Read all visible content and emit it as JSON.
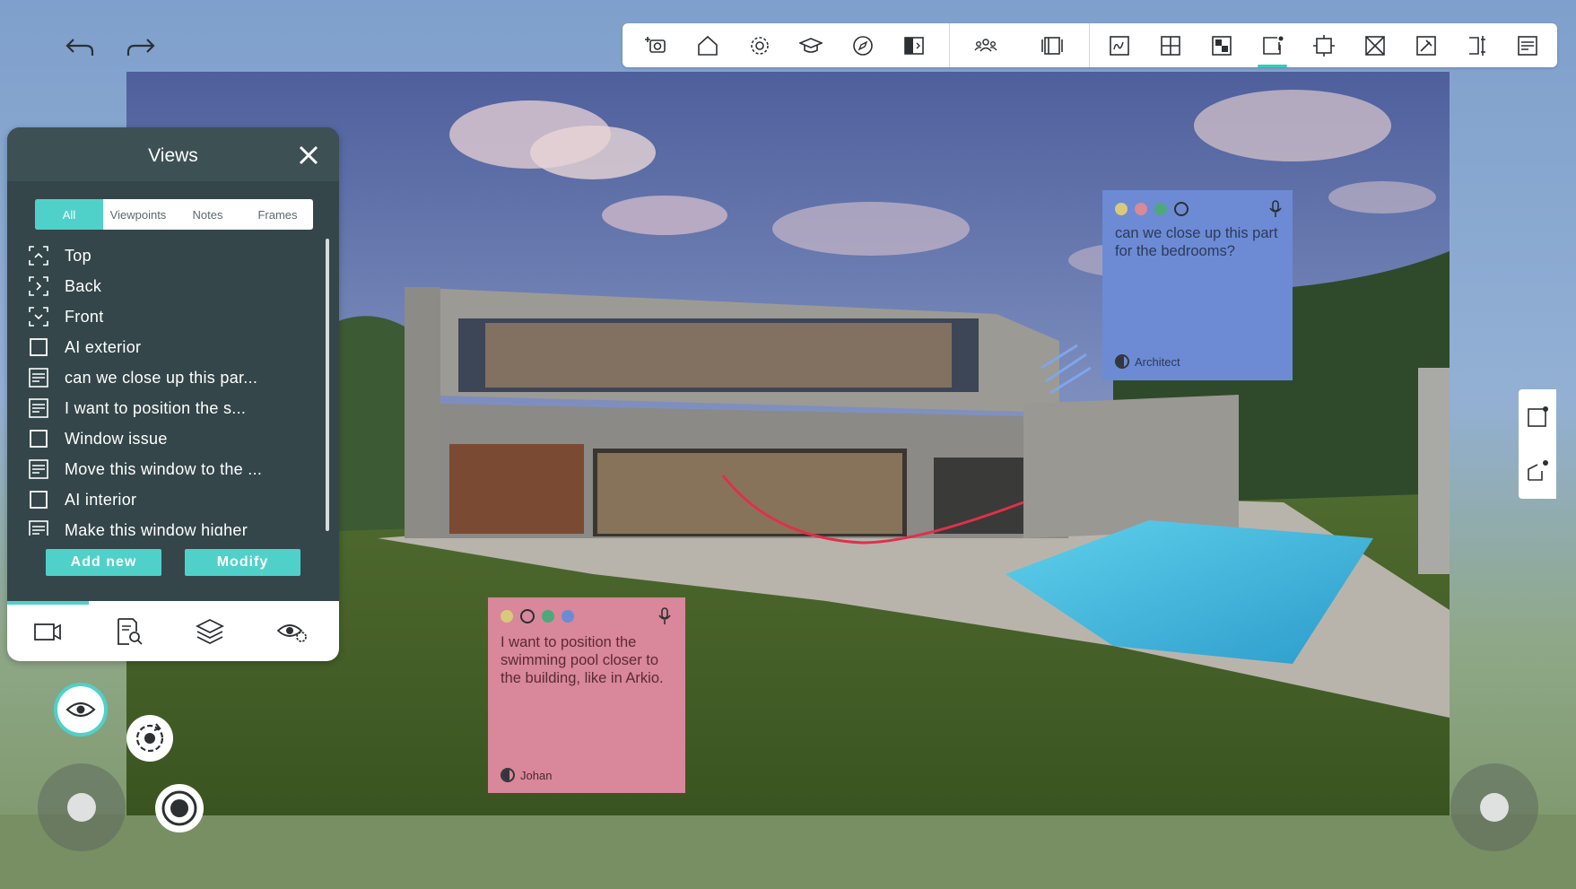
{
  "history": {
    "undo_icon": "undo-icon",
    "redo_icon": "redo-icon"
  },
  "toolbar": {
    "tools": [
      {
        "name": "add-viewpoint",
        "icon": "camera-plus-icon"
      },
      {
        "name": "home",
        "icon": "home-icon"
      },
      {
        "name": "settings",
        "icon": "gear-icon"
      },
      {
        "name": "tutorial",
        "icon": "graduation-cap-icon"
      },
      {
        "name": "compass",
        "icon": "compass-icon"
      },
      {
        "name": "split-view",
        "icon": "split-panel-icon"
      },
      {
        "name": "users",
        "icon": "users-icon"
      },
      {
        "name": "panels",
        "icon": "panels-icon"
      },
      {
        "name": "sketch",
        "icon": "sketch-icon"
      },
      {
        "name": "add-object",
        "icon": "plus-square-icon"
      },
      {
        "name": "materials",
        "icon": "checker-icon"
      },
      {
        "name": "views",
        "icon": "view-frame-icon"
      },
      {
        "name": "frame-select",
        "icon": "frame-select-icon"
      },
      {
        "name": "remove",
        "icon": "x-square-icon"
      },
      {
        "name": "pin",
        "icon": "pin-icon"
      },
      {
        "name": "section",
        "icon": "section-icon"
      },
      {
        "name": "notes",
        "icon": "notes-icon"
      }
    ],
    "active_tool": "views",
    "accent_color": "#2fd0b7"
  },
  "views_panel": {
    "title": "Views",
    "tabs": [
      {
        "label": "All",
        "active": true
      },
      {
        "label": "Viewpoints",
        "active": false
      },
      {
        "label": "Notes",
        "active": false
      },
      {
        "label": "Frames",
        "active": false
      }
    ],
    "items": [
      {
        "label": "Top",
        "icon": "viewpoint-icon"
      },
      {
        "label": "Back",
        "icon": "viewpoint-icon"
      },
      {
        "label": "Front",
        "icon": "viewpoint-icon"
      },
      {
        "label": "AI exterior",
        "icon": "frame-icon"
      },
      {
        "label": "can we close up this par...",
        "icon": "note-icon"
      },
      {
        "label": "I want to position the s...",
        "icon": "note-icon"
      },
      {
        "label": "Window issue",
        "icon": "frame-icon"
      },
      {
        "label": "Move this window to the ...",
        "icon": "note-icon"
      },
      {
        "label": "AI interior",
        "icon": "frame-icon"
      },
      {
        "label": "Make this window higher",
        "icon": "note-icon"
      }
    ],
    "add_label": "Add new",
    "modify_label": "Modify",
    "bottom_tabs": [
      {
        "name": "camera",
        "icon": "camera-icon"
      },
      {
        "name": "search-document",
        "icon": "document-search-icon"
      },
      {
        "name": "layers",
        "icon": "layers-icon"
      },
      {
        "name": "visibility-settings",
        "icon": "eye-gear-icon"
      }
    ],
    "accent_color": "#4fd1c9"
  },
  "notes": [
    {
      "text": "can we close up this part for the bedrooms?",
      "author": "Architect",
      "bg": "#6c8bd4",
      "colors": [
        "#d9c97a",
        "#d98a96",
        "#4fa87c",
        "ring"
      ]
    },
    {
      "text": "I want to position the swimming pool closer to the building, like in Arkio.",
      "author": "Johan",
      "bg": "#d9879a",
      "colors": [
        "#d9c97a",
        "ring",
        "#4fa87c",
        "#6c8bd4"
      ]
    }
  ],
  "side_tools": [
    {
      "name": "frame-point",
      "icon": "frame-point-icon"
    },
    {
      "name": "draw-point",
      "icon": "draw-point-icon"
    }
  ],
  "controls": {
    "eye_icon": "eye-icon",
    "rotate_icon": "rotate-icon",
    "record_icon": "record-icon",
    "left_joystick": "joystick",
    "right_joystick": "joystick"
  }
}
